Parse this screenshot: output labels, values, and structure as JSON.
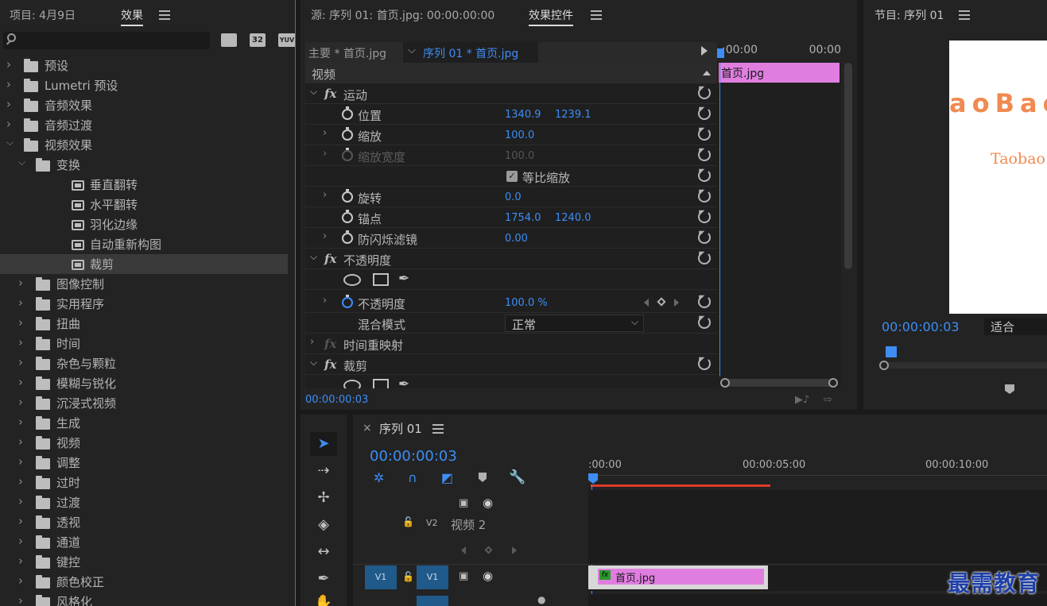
{
  "left_panel": {
    "tab_project": "项目: 4月9日",
    "tab_effects": "效果",
    "search_placeholder": "",
    "filter_badges": [
      "32",
      "YUV"
    ],
    "tree": [
      {
        "label": "预设",
        "type": "preset-folder",
        "level": 0,
        "expanded": false
      },
      {
        "label": "Lumetri 预设",
        "type": "preset-folder",
        "level": 0,
        "expanded": false
      },
      {
        "label": "音频效果",
        "type": "folder",
        "level": 0,
        "expanded": false
      },
      {
        "label": "音频过渡",
        "type": "folder",
        "level": 0,
        "expanded": false
      },
      {
        "label": "视频效果",
        "type": "folder",
        "level": 0,
        "expanded": true
      },
      {
        "label": "变换",
        "type": "folder",
        "level": 1,
        "expanded": true
      },
      {
        "label": "垂直翻转",
        "type": "effect",
        "level": 2
      },
      {
        "label": "水平翻转",
        "type": "effect",
        "level": 2
      },
      {
        "label": "羽化边缘",
        "type": "effect",
        "level": 2
      },
      {
        "label": "自动重新构图",
        "type": "effect",
        "level": 2
      },
      {
        "label": "裁剪",
        "type": "effect",
        "level": 2,
        "selected": true
      },
      {
        "label": "图像控制",
        "type": "folder",
        "level": 1,
        "expanded": false
      },
      {
        "label": "实用程序",
        "type": "folder",
        "level": 1,
        "expanded": false
      },
      {
        "label": "扭曲",
        "type": "folder",
        "level": 1,
        "expanded": false
      },
      {
        "label": "时间",
        "type": "folder",
        "level": 1,
        "expanded": false
      },
      {
        "label": "杂色与颗粒",
        "type": "folder",
        "level": 1,
        "expanded": false
      },
      {
        "label": "模糊与锐化",
        "type": "folder",
        "level": 1,
        "expanded": false
      },
      {
        "label": "沉浸式视频",
        "type": "folder",
        "level": 1,
        "expanded": false
      },
      {
        "label": "生成",
        "type": "folder",
        "level": 1,
        "expanded": false
      },
      {
        "label": "视频",
        "type": "folder",
        "level": 1,
        "expanded": false
      },
      {
        "label": "调整",
        "type": "folder",
        "level": 1,
        "expanded": false
      },
      {
        "label": "过时",
        "type": "folder",
        "level": 1,
        "expanded": false
      },
      {
        "label": "过渡",
        "type": "folder",
        "level": 1,
        "expanded": false
      },
      {
        "label": "透视",
        "type": "folder",
        "level": 1,
        "expanded": false
      },
      {
        "label": "通道",
        "type": "folder",
        "level": 1,
        "expanded": false
      },
      {
        "label": "键控",
        "type": "folder",
        "level": 1,
        "expanded": false
      },
      {
        "label": "颜色校正",
        "type": "folder",
        "level": 1,
        "expanded": false
      },
      {
        "label": "风格化",
        "type": "folder",
        "level": 1,
        "expanded": false
      }
    ]
  },
  "effect_controls": {
    "tab_source": "源: 序列 01: 首页.jpg: 00:00:00:00",
    "tab_effect_controls": "效果控件",
    "master_label": "主要 * 首页.jpg",
    "sequence_label": "序列 01 * 首页.jpg",
    "section_video": "视频",
    "time_start": ":00:00",
    "time_end": "00:00",
    "clip_label": "首页.jpg",
    "current_time": "00:00:00:03",
    "rows": {
      "motion": "运动",
      "position": "位置",
      "position_x": "1340.9",
      "position_y": "1239.1",
      "scale": "缩放",
      "scale_val": "100.0",
      "scale_width": "缩放宽度",
      "scale_width_val": "100.0",
      "uniform_scale": "等比缩放",
      "rotation": "旋转",
      "rotation_val": "0.0",
      "anchor": "锚点",
      "anchor_x": "1754.0",
      "anchor_y": "1240.0",
      "anti_flicker": "防闪烁滤镜",
      "anti_flicker_val": "0.00",
      "opacity_group": "不透明度",
      "opacity": "不透明度",
      "opacity_val": "100.0 %",
      "blend_mode": "混合模式",
      "blend_mode_val": "正常",
      "time_remap": "时间重映射",
      "crop": "裁剪"
    }
  },
  "program": {
    "title": "节目: 序列 01",
    "timecode": "00:00:00:03",
    "fit": "适合",
    "frame_text_big": "aoBao",
    "frame_text_small": "Taobao"
  },
  "timeline": {
    "close": "×",
    "title": "序列 01",
    "timecode": "00:00:00:03",
    "ruler": [
      ":00:00",
      "00:00:05:00",
      "00:00:10:00"
    ],
    "tracks": {
      "v2_label": "V2",
      "v2_name": "视频 2",
      "v1_src": "V1",
      "v1_label": "V1",
      "clip_name": "首页.jpg",
      "clip_fx": "fx"
    }
  },
  "watermark": "最需教育",
  "colors": {
    "accent_blue": "#3d8df5",
    "clip_pink": "#e07ee0",
    "orange_text": "#f08a50",
    "work_area_red": "#e03a2a"
  }
}
